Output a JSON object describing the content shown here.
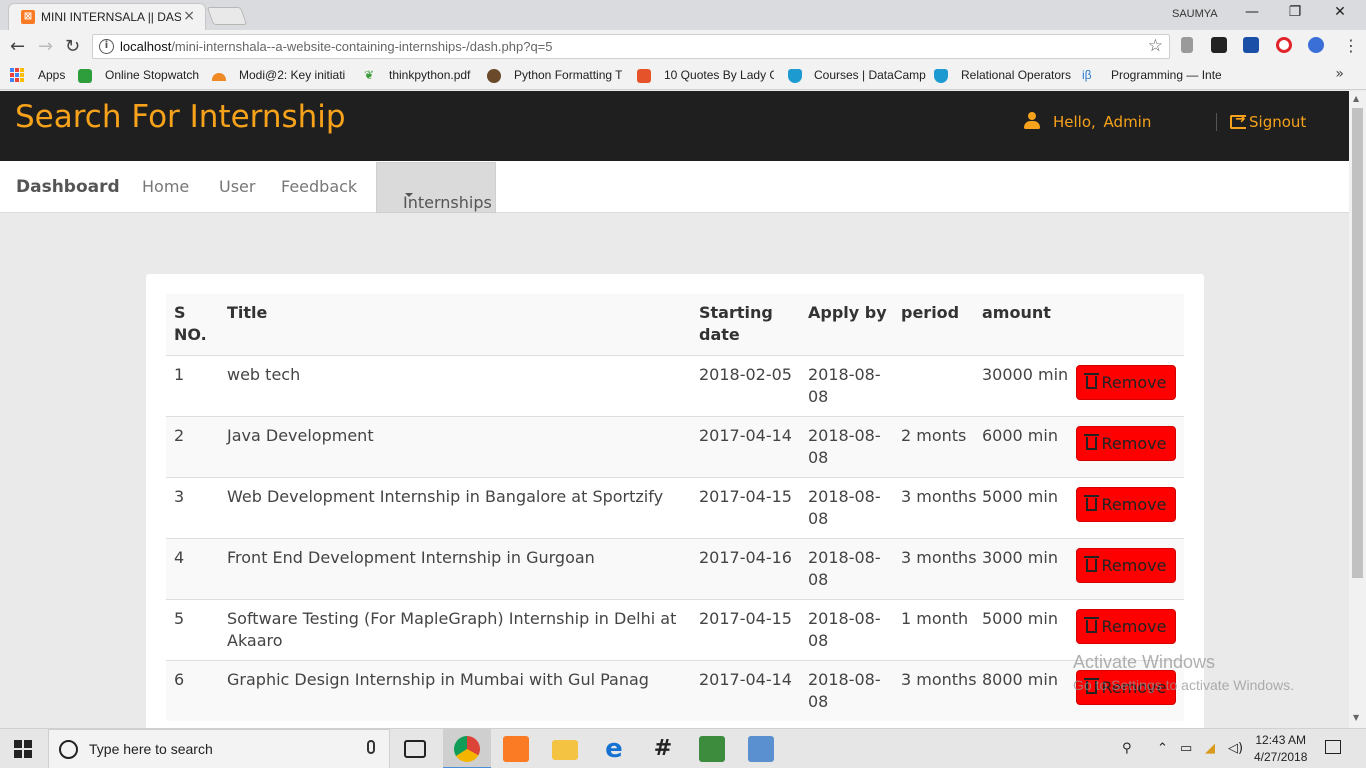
{
  "browser": {
    "tab_title": "MINI INTERNSALA || DAS",
    "tab_close": "×",
    "profile_name": "SAUMYA",
    "window_buttons": [
      "—",
      "❐",
      "✕"
    ],
    "url_host": "localhost",
    "url_path": "/mini-internshala--a-website-containing-internships-/dash.php?q=5",
    "bookmarks": [
      "Apps",
      "Online Stopwatch",
      "Modi@2: Key initiati",
      "thinkpython.pdf",
      "Python Formatting T",
      "10 Quotes By Lady G",
      "Courses | DataCamp",
      "Relational Operators",
      "Programming — Inte"
    ],
    "bookmarks_more": "»"
  },
  "header": {
    "title": "Search For Internship",
    "greeting": "Hello,  Admin",
    "signout": "Signout"
  },
  "nav": {
    "brand": "Dashboard",
    "links": [
      "Home",
      "User",
      "Feedback"
    ],
    "active": "Internships"
  },
  "table": {
    "headers": [
      "S NO.",
      "Title",
      "Starting date",
      "Apply by",
      "period",
      "amount"
    ],
    "remove_label": "Remove",
    "rows": [
      {
        "sno": "1",
        "title": "web tech",
        "start": "2018-02-05",
        "apply": "2018-08-08",
        "period": "",
        "amount": "30000 min"
      },
      {
        "sno": "2",
        "title": "Java Development",
        "start": "2017-04-14",
        "apply": "2018-08-08",
        "period": "2 monts",
        "amount": "6000 min"
      },
      {
        "sno": "3",
        "title": "Web Development Internship in Bangalore at Sportzify",
        "start": "2017-04-15",
        "apply": "2018-08-08",
        "period": "3 months",
        "amount": "5000 min"
      },
      {
        "sno": "4",
        "title": "Front End Development Internship in Gurgoan",
        "start": "2017-04-16",
        "apply": "2018-08-08",
        "period": "3 months",
        "amount": "3000 min"
      },
      {
        "sno": "5",
        "title": "Software Testing (For MapleGraph) Internship in Delhi at Akaaro",
        "start": "2017-04-15",
        "apply": "2018-08-08",
        "period": "1 month",
        "amount": "5000 min"
      },
      {
        "sno": "6",
        "title": "Graphic Design Internship in Mumbai with Gul Panag",
        "start": "2017-04-14",
        "apply": "2018-08-08",
        "period": "3 months",
        "amount": "8000 min"
      }
    ]
  },
  "watermark": {
    "line1": "Activate Windows",
    "line2": "Go to Settings to activate Windows."
  },
  "taskbar": {
    "search_placeholder": "Type here to search",
    "time": "12:43 AM",
    "date": "4/27/2018"
  },
  "colors": {
    "accent": "#f7a21b",
    "header_bg": "#1f1f1f",
    "remove_btn": "#ff0000"
  }
}
